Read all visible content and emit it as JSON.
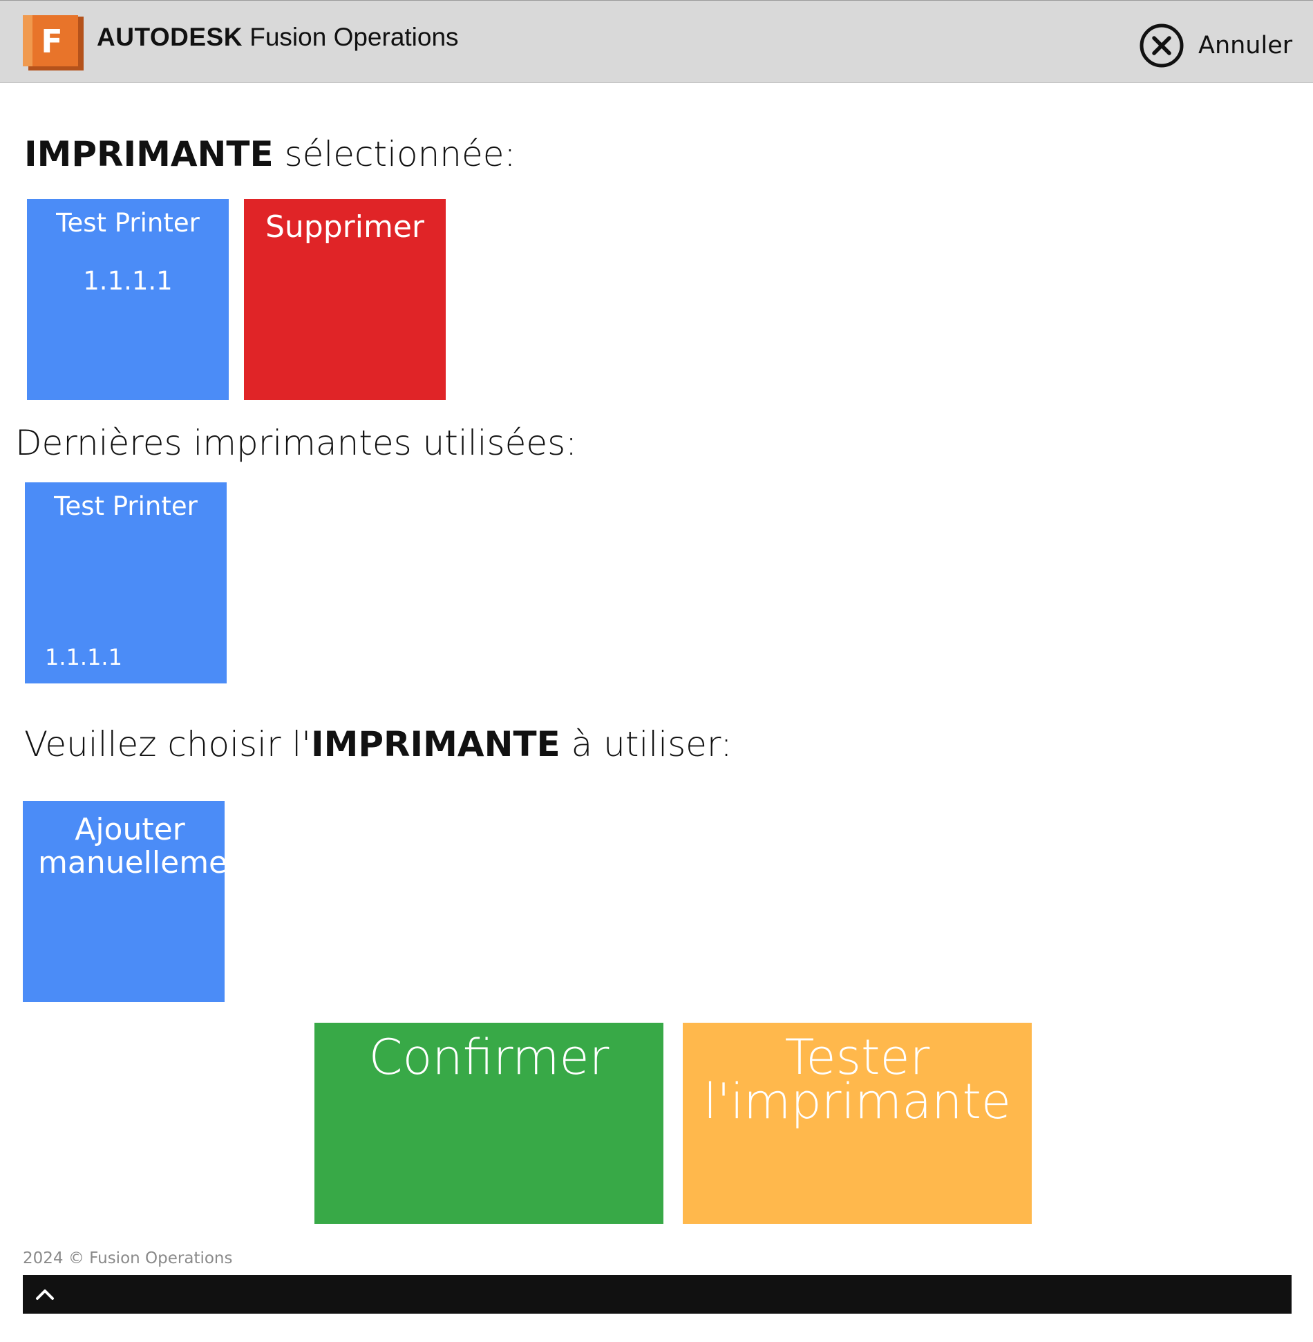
{
  "header": {
    "logo_letter": "F",
    "brand_bold": "AUTODESK",
    "brand_product": "Fusion Operations",
    "cancel_label": "Annuler"
  },
  "selected_section": {
    "heading_bold": "IMPRIMANTE",
    "heading_rest": " sélectionnée:",
    "printer_name": "Test Printer",
    "printer_ip": "1.1.1.1",
    "delete_label": "Supprimer"
  },
  "recent_section": {
    "heading": "Dernières imprimantes utilisées:",
    "items": [
      {
        "name": "Test Printer",
        "ip": "1.1.1.1"
      }
    ]
  },
  "choose_section": {
    "heading_pre": "Veuillez choisir l'",
    "heading_bold": "IMPRIMANTE",
    "heading_post": " à utiliser:",
    "add_manual_line1": "Ajouter",
    "add_manual_line2": "manuellement"
  },
  "actions": {
    "confirm_label": "Confirmer",
    "test_line1": "Tester",
    "test_line2": "l'imprimante"
  },
  "footer": {
    "copyright": "2024 © Fusion Operations"
  },
  "colors": {
    "header_bg": "#d9d9d9",
    "tile_blue": "#4b8cf7",
    "delete_red": "#e02427",
    "confirm_green": "#38a947",
    "test_orange": "#ffb84c",
    "logo_orange": "#e8742a",
    "bottom_bar": "#111111"
  },
  "icons": {
    "logo": "fusion-logo-icon",
    "cancel": "close-circle-icon",
    "scroll_top": "chevron-up-icon"
  }
}
